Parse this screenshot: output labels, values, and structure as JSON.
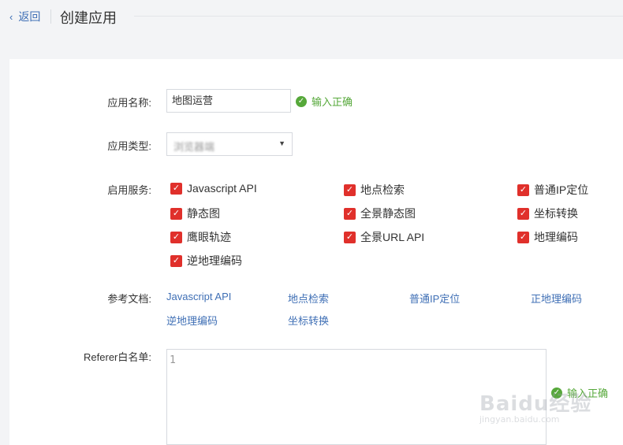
{
  "header": {
    "back_label": "返回",
    "title": "创建应用"
  },
  "form": {
    "app_name_label": "应用名称:",
    "app_name_value": "地图运营",
    "app_name_status": "输入正确",
    "app_type_label": "应用类型:",
    "app_type_value": "浏览器端",
    "services_label": "启用服务:",
    "services": [
      {
        "label": "Javascript API",
        "checked": true
      },
      {
        "label": "地点检索",
        "checked": true
      },
      {
        "label": "普通IP定位",
        "checked": true
      },
      {
        "label": "静态图",
        "checked": true
      },
      {
        "label": "全景静态图",
        "checked": true
      },
      {
        "label": "坐标转换",
        "checked": true
      },
      {
        "label": "鹰眼轨迹",
        "checked": true
      },
      {
        "label": "全景URL API",
        "checked": true
      },
      {
        "label": "地理编码",
        "checked": true
      },
      {
        "label": "逆地理编码",
        "checked": true
      }
    ],
    "docs_label": "参考文档:",
    "docs": [
      "Javascript API",
      "地点检索",
      "普通IP定位",
      "正地理编码",
      "逆地理编码",
      "坐标转换"
    ],
    "referer_label": "Referer白名单:",
    "referer_value": "1",
    "referer_status": "输入正确"
  },
  "icons": {
    "back": "chevron-left-icon",
    "ok": "check-circle-icon",
    "checkbox": "checkbox-checked-icon",
    "dropdown": "caret-down-icon"
  },
  "colors": {
    "link": "#3f6fb5",
    "success": "#56a83a",
    "checkbox": "#e0302b"
  },
  "watermark": {
    "brand": "Baidu经验",
    "url": "jingyan.baidu.com"
  }
}
